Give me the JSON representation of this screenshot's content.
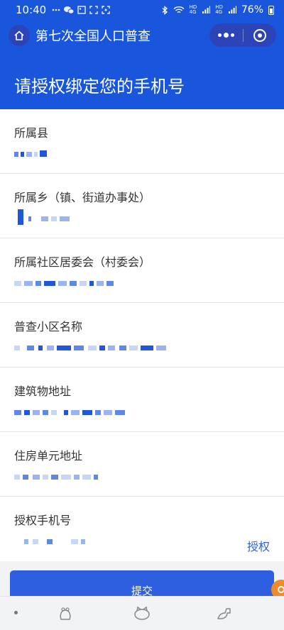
{
  "status_bar": {
    "time": "10:40",
    "battery": "76%"
  },
  "nav": {
    "title": "第七次全国人口普查"
  },
  "header": {
    "title": "请授权绑定您的手机号"
  },
  "form": {
    "fields": [
      {
        "label": "所属县"
      },
      {
        "label": "所属乡（镇、街道办事处）"
      },
      {
        "label": "所属社区居委会（村委会）"
      },
      {
        "label": "普查小区名称"
      },
      {
        "label": "建筑物地址"
      },
      {
        "label": "住房单元地址"
      },
      {
        "label": "授权手机号"
      }
    ],
    "authorize_label": "授权"
  },
  "submit_label": "提交",
  "colors": {
    "brand_blue": "#1a56db",
    "button_blue": "#2d5fe0",
    "link_blue": "#2f5fd6"
  }
}
